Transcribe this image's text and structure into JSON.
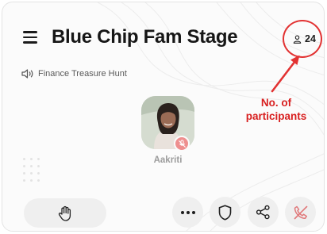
{
  "header": {
    "title": "Blue Chip Fam Stage",
    "menu_icon": "hamburger-menu-icon",
    "participant_icon": "person-icon",
    "participant_count": "24"
  },
  "topic": {
    "icon": "speaker-icon",
    "label": "Finance Treasure Hunt"
  },
  "speaker": {
    "name": "Aakriti",
    "status_icon": "mic-off-icon"
  },
  "annotation": {
    "text_line1": "No. of",
    "text_line2": "participants",
    "color": "#e23232"
  },
  "controls": {
    "raise_hand_icon": "raise-hand-icon",
    "more_icon": "more-dots-icon",
    "shield_icon": "shield-icon",
    "share_icon": "share-icon",
    "leave_icon": "phone-hangup-icon",
    "leave_color": "#e0787a"
  }
}
